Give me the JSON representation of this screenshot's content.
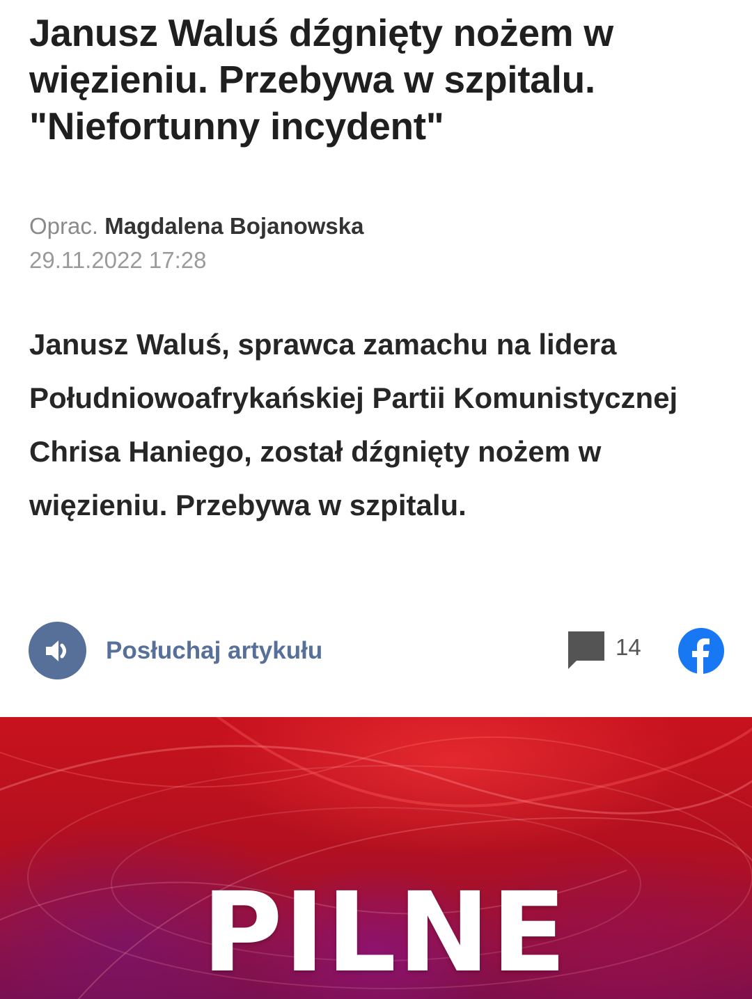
{
  "article": {
    "headline": "Janusz Waluś dźgnięty nożem w więzieniu. Przebywa w szpitalu. \"Niefortunny incydent\"",
    "byline_prefix": "Oprac.",
    "author": "Magdalena Bojanowska",
    "date": "29.11.2022 17:28",
    "lead": "Janusz Waluś, sprawca zamachu na lidera Południowoafrykańskiej Partii Komunistycznej Chrisa Haniego, został dźgnięty nożem w więzieniu. Przebywa w szpitalu."
  },
  "actions": {
    "listen_label": "Posłuchaj artykułu",
    "listen_icon": "speaker-icon",
    "comments_icon": "comment-icon",
    "comments_count": "14",
    "share_icon": "facebook-icon"
  },
  "banner": {
    "text": "PILNE"
  },
  "colors": {
    "accent": "#56709a",
    "facebook": "#1877f2",
    "banner_red": "#c8121e"
  }
}
